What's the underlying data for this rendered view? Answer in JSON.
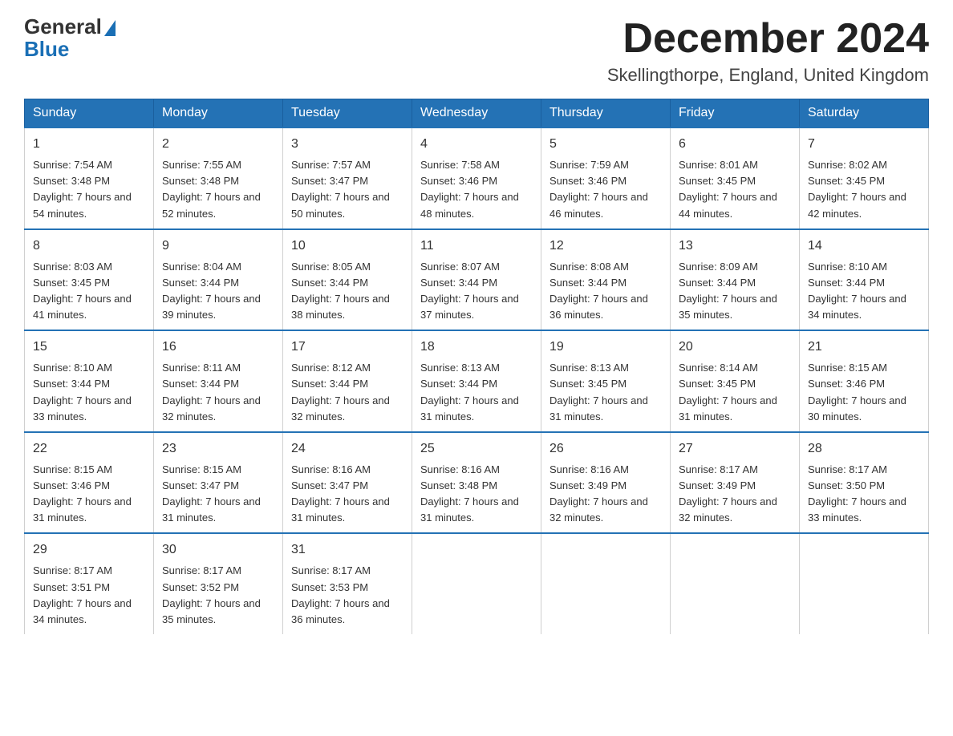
{
  "logo": {
    "general": "General",
    "blue": "Blue"
  },
  "title": "December 2024",
  "location": "Skellingthorpe, England, United Kingdom",
  "days_of_week": [
    "Sunday",
    "Monday",
    "Tuesday",
    "Wednesday",
    "Thursday",
    "Friday",
    "Saturday"
  ],
  "weeks": [
    [
      {
        "day": "1",
        "sunrise": "7:54 AM",
        "sunset": "3:48 PM",
        "daylight": "7 hours and 54 minutes."
      },
      {
        "day": "2",
        "sunrise": "7:55 AM",
        "sunset": "3:48 PM",
        "daylight": "7 hours and 52 minutes."
      },
      {
        "day": "3",
        "sunrise": "7:57 AM",
        "sunset": "3:47 PM",
        "daylight": "7 hours and 50 minutes."
      },
      {
        "day": "4",
        "sunrise": "7:58 AM",
        "sunset": "3:46 PM",
        "daylight": "7 hours and 48 minutes."
      },
      {
        "day": "5",
        "sunrise": "7:59 AM",
        "sunset": "3:46 PM",
        "daylight": "7 hours and 46 minutes."
      },
      {
        "day": "6",
        "sunrise": "8:01 AM",
        "sunset": "3:45 PM",
        "daylight": "7 hours and 44 minutes."
      },
      {
        "day": "7",
        "sunrise": "8:02 AM",
        "sunset": "3:45 PM",
        "daylight": "7 hours and 42 minutes."
      }
    ],
    [
      {
        "day": "8",
        "sunrise": "8:03 AM",
        "sunset": "3:45 PM",
        "daylight": "7 hours and 41 minutes."
      },
      {
        "day": "9",
        "sunrise": "8:04 AM",
        "sunset": "3:44 PM",
        "daylight": "7 hours and 39 minutes."
      },
      {
        "day": "10",
        "sunrise": "8:05 AM",
        "sunset": "3:44 PM",
        "daylight": "7 hours and 38 minutes."
      },
      {
        "day": "11",
        "sunrise": "8:07 AM",
        "sunset": "3:44 PM",
        "daylight": "7 hours and 37 minutes."
      },
      {
        "day": "12",
        "sunrise": "8:08 AM",
        "sunset": "3:44 PM",
        "daylight": "7 hours and 36 minutes."
      },
      {
        "day": "13",
        "sunrise": "8:09 AM",
        "sunset": "3:44 PM",
        "daylight": "7 hours and 35 minutes."
      },
      {
        "day": "14",
        "sunrise": "8:10 AM",
        "sunset": "3:44 PM",
        "daylight": "7 hours and 34 minutes."
      }
    ],
    [
      {
        "day": "15",
        "sunrise": "8:10 AM",
        "sunset": "3:44 PM",
        "daylight": "7 hours and 33 minutes."
      },
      {
        "day": "16",
        "sunrise": "8:11 AM",
        "sunset": "3:44 PM",
        "daylight": "7 hours and 32 minutes."
      },
      {
        "day": "17",
        "sunrise": "8:12 AM",
        "sunset": "3:44 PM",
        "daylight": "7 hours and 32 minutes."
      },
      {
        "day": "18",
        "sunrise": "8:13 AM",
        "sunset": "3:44 PM",
        "daylight": "7 hours and 31 minutes."
      },
      {
        "day": "19",
        "sunrise": "8:13 AM",
        "sunset": "3:45 PM",
        "daylight": "7 hours and 31 minutes."
      },
      {
        "day": "20",
        "sunrise": "8:14 AM",
        "sunset": "3:45 PM",
        "daylight": "7 hours and 31 minutes."
      },
      {
        "day": "21",
        "sunrise": "8:15 AM",
        "sunset": "3:46 PM",
        "daylight": "7 hours and 30 minutes."
      }
    ],
    [
      {
        "day": "22",
        "sunrise": "8:15 AM",
        "sunset": "3:46 PM",
        "daylight": "7 hours and 31 minutes."
      },
      {
        "day": "23",
        "sunrise": "8:15 AM",
        "sunset": "3:47 PM",
        "daylight": "7 hours and 31 minutes."
      },
      {
        "day": "24",
        "sunrise": "8:16 AM",
        "sunset": "3:47 PM",
        "daylight": "7 hours and 31 minutes."
      },
      {
        "day": "25",
        "sunrise": "8:16 AM",
        "sunset": "3:48 PM",
        "daylight": "7 hours and 31 minutes."
      },
      {
        "day": "26",
        "sunrise": "8:16 AM",
        "sunset": "3:49 PM",
        "daylight": "7 hours and 32 minutes."
      },
      {
        "day": "27",
        "sunrise": "8:17 AM",
        "sunset": "3:49 PM",
        "daylight": "7 hours and 32 minutes."
      },
      {
        "day": "28",
        "sunrise": "8:17 AM",
        "sunset": "3:50 PM",
        "daylight": "7 hours and 33 minutes."
      }
    ],
    [
      {
        "day": "29",
        "sunrise": "8:17 AM",
        "sunset": "3:51 PM",
        "daylight": "7 hours and 34 minutes."
      },
      {
        "day": "30",
        "sunrise": "8:17 AM",
        "sunset": "3:52 PM",
        "daylight": "7 hours and 35 minutes."
      },
      {
        "day": "31",
        "sunrise": "8:17 AM",
        "sunset": "3:53 PM",
        "daylight": "7 hours and 36 minutes."
      },
      null,
      null,
      null,
      null
    ]
  ]
}
